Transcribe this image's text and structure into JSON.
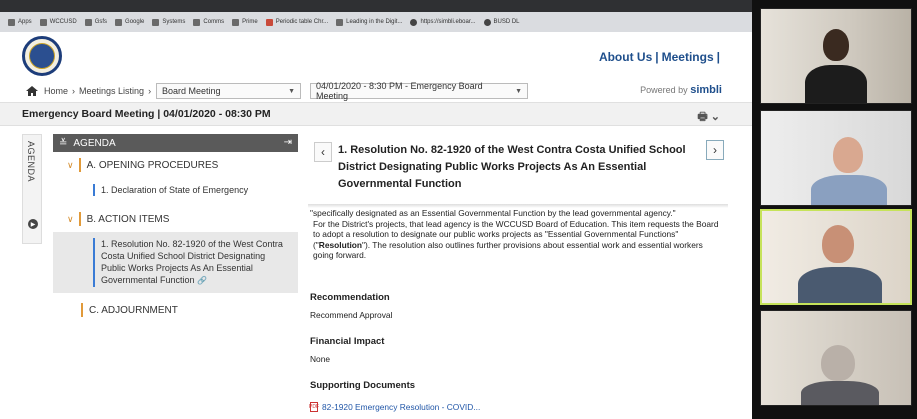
{
  "bookmarks": [
    {
      "label": "Apps",
      "icon": "apps-icon"
    },
    {
      "label": "WCCUSD",
      "icon": "folder-icon"
    },
    {
      "label": "Gsfs",
      "icon": "folder-icon"
    },
    {
      "label": "Google",
      "icon": "folder-icon"
    },
    {
      "label": "Systems",
      "icon": "folder-icon"
    },
    {
      "label": "Comms",
      "icon": "folder-icon"
    },
    {
      "label": "Prime",
      "icon": "folder-icon"
    },
    {
      "label": "Periodic table Chr...",
      "icon": "bookmark-icon"
    },
    {
      "label": "Leading in the Digit...",
      "icon": "bookmark-icon"
    },
    {
      "label": "https://simbli.eboar...",
      "icon": "bookmark-icon"
    },
    {
      "label": "BUSD DL",
      "icon": "bookmark-icon"
    }
  ],
  "header": {
    "links": [
      "About Us",
      "Meetings"
    ],
    "separator": "|"
  },
  "crumbs": {
    "home": "Home",
    "listing": "Meetings Listing",
    "meeting_type": "Board Meeting",
    "meeting_date": "04/01/2020 - 8:30 PM - Emergency Board Meeting",
    "powered_prefix": "Powered by",
    "powered_brand": "simbli"
  },
  "meeting_title": "Emergency Board Meeting | 04/01/2020 - 08:30 PM",
  "vtab_label": "AGENDA",
  "agenda": {
    "title": "AGENDA",
    "sections": [
      {
        "label": "A. OPENING PROCEDURES",
        "items": [
          "1. Declaration of State of Emergency"
        ]
      },
      {
        "label": "B. ACTION ITEMS",
        "items": [
          "1. Resolution No. 82-1920 of the West Contra Costa Unified School District Designating Public Works Projects As An Essential Governmental Function"
        ]
      },
      {
        "label": "C. ADJOURNMENT",
        "items": []
      }
    ]
  },
  "content": {
    "title": "1. Resolution No. 82-1920 of the West Contra Costa Unified School District Designating Public Works Projects As An Essential Governmental Function",
    "body_1": "\"specifically designated as an Essential Governmental Function by the lead governmental agency.\"",
    "body_2": "For the District's projects, that lead agency is the WCCUSD Board of Education.  This item requests the Board to adopt a resolution to designate our public works projects as \"Essential Governmental Functions\" (\"",
    "body_bold": "Resolution",
    "body_3": "\").  The resolution also outlines further provisions about essential work and essential workers going forward.",
    "recommendation_heading": "Recommendation",
    "recommendation": "Recommend Approval",
    "financial_heading": "Financial Impact",
    "financial": "None",
    "docs_heading": "Supporting Documents",
    "doc_link": "82-1920 Emergency Resolution - COVID..."
  },
  "colors": {
    "link": "#1f4f8c",
    "accent_orange": "#e19a3a",
    "agenda_header": "#5a5a5a",
    "active_speaker": "#c6e35a"
  }
}
